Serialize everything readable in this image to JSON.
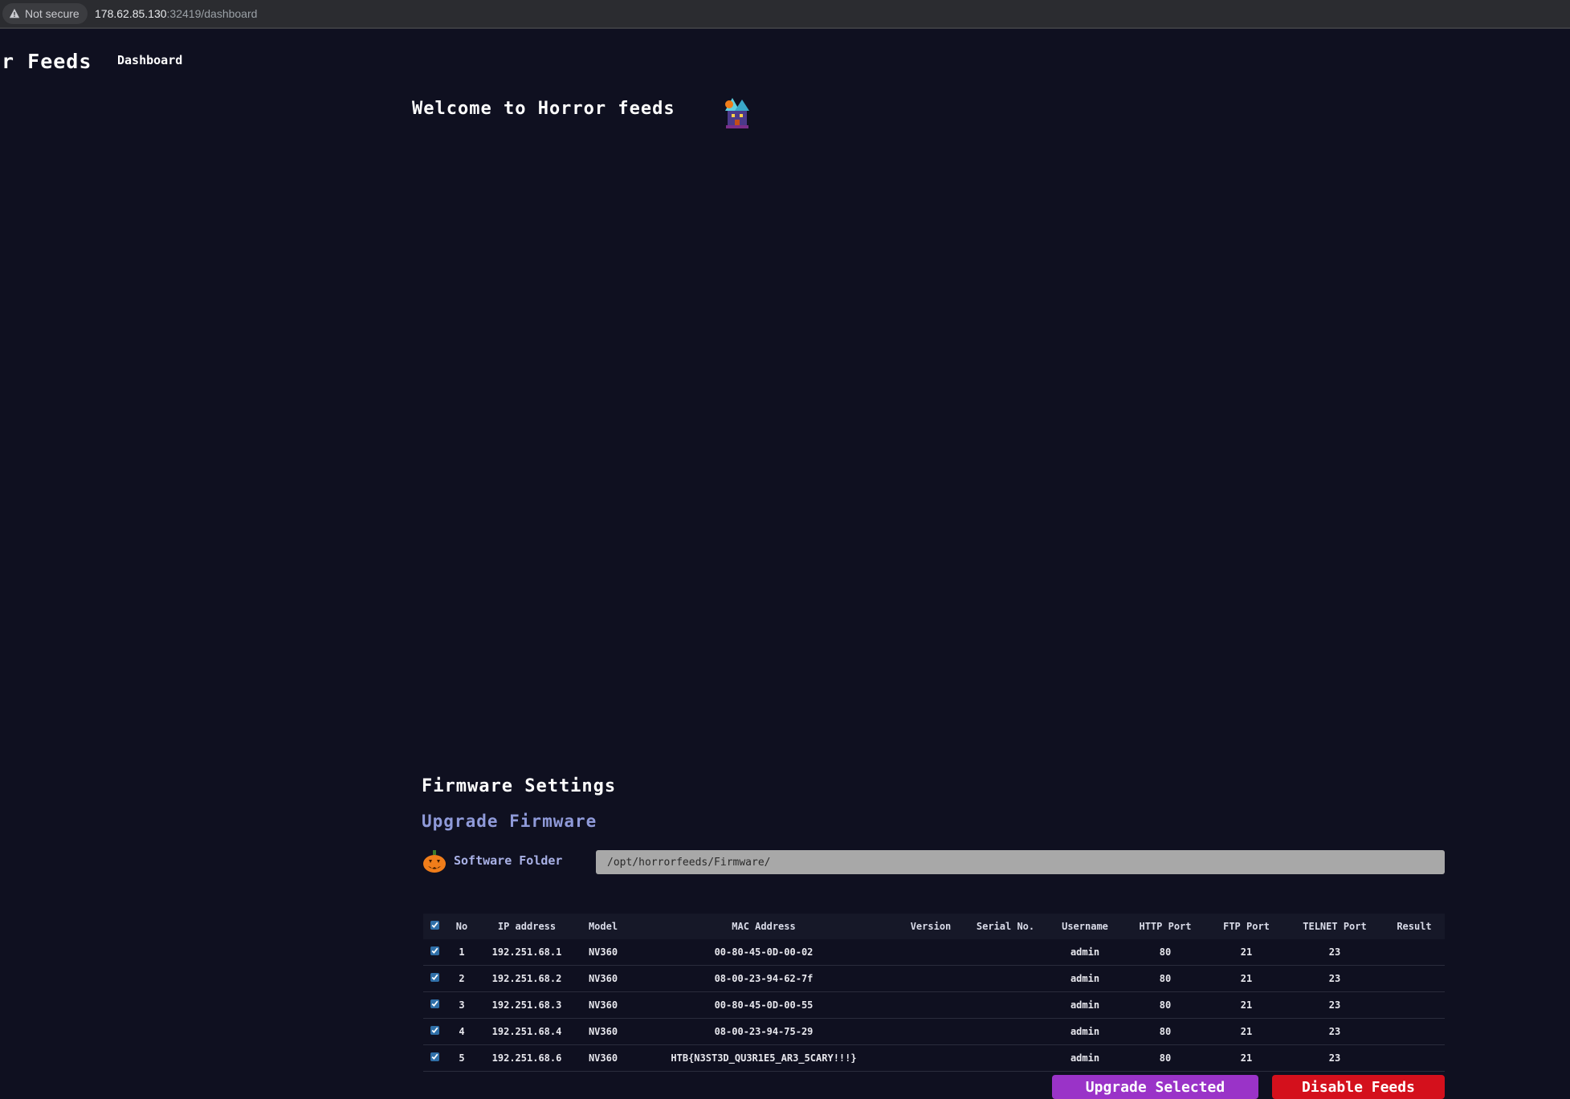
{
  "browser": {
    "security_label": "Not secure",
    "url_host": "178.62.85.130",
    "url_rest": ":32419/dashboard"
  },
  "nav": {
    "brand": "or Feeds",
    "dashboard_link": "Dashboard"
  },
  "main": {
    "welcome": "Welcome to Horror feeds"
  },
  "firmware": {
    "title": "Firmware Settings",
    "subtitle": "Upgrade Firmware",
    "folder_label": "Software Folder",
    "folder_value": "/opt/horrorfeeds/Firmware/"
  },
  "table": {
    "headers": [
      "No",
      "IP address",
      "Model",
      "MAC Address",
      "Version",
      "Serial No.",
      "Username",
      "HTTP Port",
      "FTP Port",
      "TELNET Port",
      "Result"
    ],
    "rows": [
      [
        "1",
        "192.251.68.1",
        "NV360",
        "00-80-45-0D-00-02",
        "",
        "",
        "admin",
        "80",
        "21",
        "23",
        ""
      ],
      [
        "2",
        "192.251.68.2",
        "NV360",
        "08-00-23-94-62-7f",
        "",
        "",
        "admin",
        "80",
        "21",
        "23",
        ""
      ],
      [
        "3",
        "192.251.68.3",
        "NV360",
        "00-80-45-0D-00-55",
        "",
        "",
        "admin",
        "80",
        "21",
        "23",
        ""
      ],
      [
        "4",
        "192.251.68.4",
        "NV360",
        "08-00-23-94-75-29",
        "",
        "",
        "admin",
        "80",
        "21",
        "23",
        ""
      ],
      [
        "5",
        "192.251.68.6",
        "NV360",
        "HTB{N3ST3D_QU3R1E5_AR3_5CARY!!!}",
        "",
        "",
        "admin",
        "80",
        "21",
        "23",
        ""
      ]
    ]
  },
  "actions": {
    "upgrade_label": "Upgrade Selected",
    "disable_label": "Disable Feeds"
  },
  "colors": {
    "background": "#0f1020",
    "accent_link": "#8f9ad9",
    "upgrade_button": "#9a33c8",
    "disable_button": "#d4101c"
  }
}
